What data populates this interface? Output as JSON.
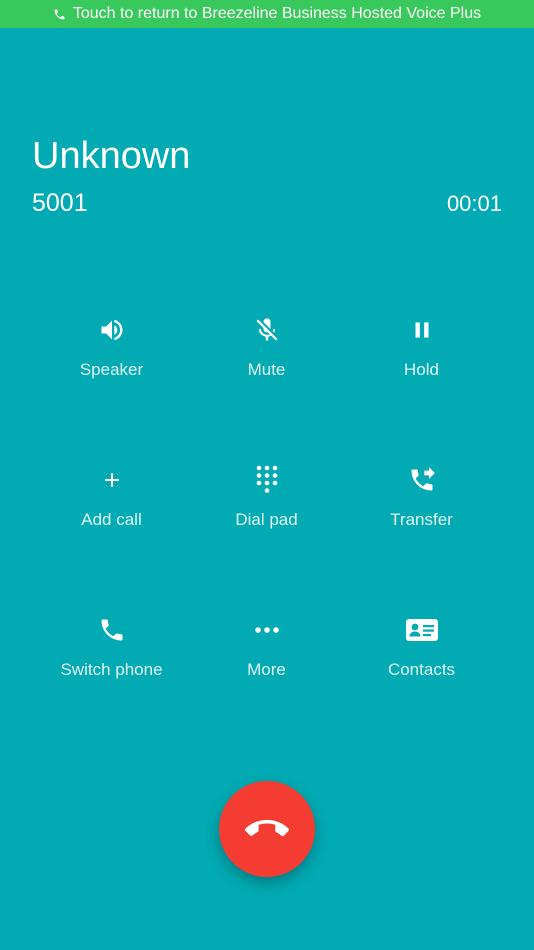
{
  "banner": {
    "text": "Touch to return to Breezeline Business Hosted Voice Plus",
    "icon": "phone-icon",
    "color": "#39c85c"
  },
  "call": {
    "name": "Unknown",
    "number": "5001",
    "timer": "00:01"
  },
  "controls": [
    {
      "label": "Speaker",
      "icon": "speaker-icon"
    },
    {
      "label": "Mute",
      "icon": "mic-off-icon"
    },
    {
      "label": "Hold",
      "icon": "pause-icon"
    },
    {
      "label": "Add call",
      "icon": "plus-icon"
    },
    {
      "label": "Dial pad",
      "icon": "dialpad-icon"
    },
    {
      "label": "Transfer",
      "icon": "phone-forward-icon"
    },
    {
      "label": "Switch phone",
      "icon": "phone-icon"
    },
    {
      "label": "More",
      "icon": "more-horizontal-icon"
    },
    {
      "label": "Contacts",
      "icon": "contact-card-icon"
    }
  ],
  "end_call": {
    "icon": "end-call-icon",
    "color": "#f53c32"
  },
  "colors": {
    "background": "#02aab3",
    "text": "#ffffff"
  }
}
